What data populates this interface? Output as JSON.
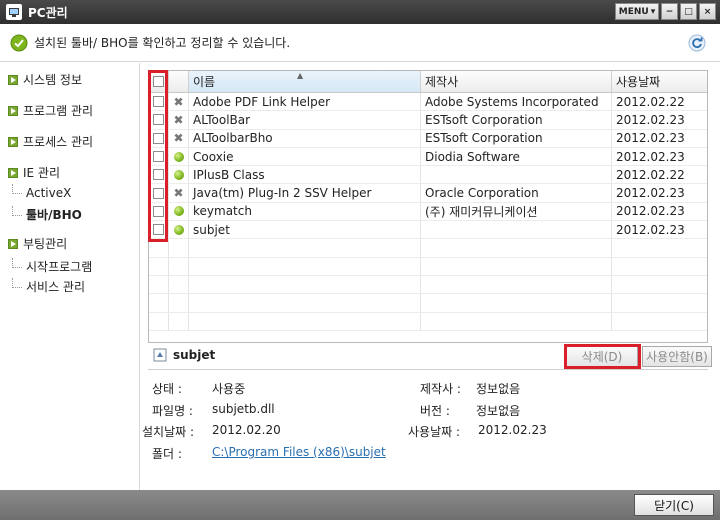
{
  "window": {
    "title": "PC관리",
    "menu_label": "MENU",
    "menu_arrow": "▾",
    "btn_minimize": "−",
    "btn_maximize": "□",
    "btn_close": "×"
  },
  "info": {
    "message": "설치된 툴바/ BHO를 확인하고 정리할 수 있습니다."
  },
  "sidebar": {
    "items": [
      {
        "label": "시스템 정보"
      },
      {
        "label": "프로그램 관리"
      },
      {
        "label": "프로세스 관리"
      },
      {
        "label": "IE 관리"
      },
      {
        "label": "부팅관리"
      }
    ],
    "ie_sub": [
      {
        "label": "ActiveX"
      },
      {
        "label": "툴바/BHO"
      }
    ],
    "boot_sub": [
      {
        "label": "시작프로그램"
      },
      {
        "label": "서비스 관리"
      }
    ]
  },
  "grid": {
    "columns": {
      "name": "이름",
      "maker": "제작사",
      "date": "사용날짜"
    },
    "sort_arrow": "▲",
    "rows": [
      {
        "status": "x",
        "name": "Adobe PDF Link Helper",
        "maker": "Adobe Systems Incorporated",
        "date": "2012.02.22"
      },
      {
        "status": "x",
        "name": "ALToolBar",
        "maker": "ESTsoft Corporation",
        "date": "2012.02.23"
      },
      {
        "status": "x",
        "name": "ALToolbarBho",
        "maker": "ESTsoft Corporation",
        "date": "2012.02.23"
      },
      {
        "status": "ok",
        "name": "Cooxie",
        "maker": "Diodia Software",
        "date": "2012.02.23"
      },
      {
        "status": "ok",
        "name": "IPlusB Class",
        "maker": "",
        "date": "2012.02.22"
      },
      {
        "status": "x",
        "name": "Java(tm) Plug-In 2 SSV Helper",
        "maker": "Oracle Corporation",
        "date": "2012.02.23"
      },
      {
        "status": "ok",
        "name": "keymatch",
        "maker": "(주) 재미커뮤니케이션",
        "date": "2012.02.23"
      },
      {
        "status": "ok",
        "name": "subjet",
        "maker": "",
        "date": "2012.02.23"
      }
    ]
  },
  "detail": {
    "name": "subjet",
    "delete_label": "삭제(D)",
    "disable_label": "사용안함(B)",
    "state_label": "상태 :",
    "state_value": "사용중",
    "maker_label": "제작사 :",
    "maker_value": "정보없음",
    "file_label": "파일명 :",
    "file_value": "subjetb.dll",
    "version_label": "버전 :",
    "version_value": "정보없음",
    "install_label": "설치날짜 :",
    "install_value": "2012.02.20",
    "used_label": "사용날짜 :",
    "used_value": "2012.02.23",
    "folder_label": "폴더 :",
    "folder_value": "C:\\Program Files (x86)\\subjet"
  },
  "footer": {
    "close_label": "닫기(C)"
  },
  "colors": {
    "highlight_box": "#d9202a",
    "ok_green": "#7cb51c",
    "link": "#2a6fb0"
  }
}
